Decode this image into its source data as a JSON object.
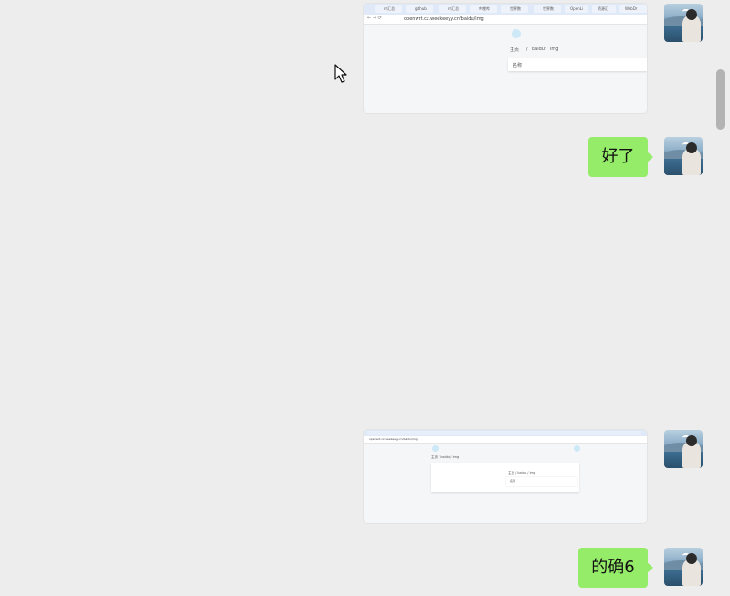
{
  "messages": [
    {
      "type": "image",
      "desc": "browser screenshot 1"
    },
    {
      "type": "text",
      "text": "好了"
    },
    {
      "type": "image",
      "desc": "browser screenshot 2"
    },
    {
      "type": "text",
      "text": "的确6"
    }
  ],
  "shot1": {
    "url": "openwrt.cz.weekeeyy.cn/baidu/img",
    "breadcrumb_home": "主页",
    "breadcrumb_sep1": "/",
    "breadcrumb_c1": "baidu",
    "breadcrumb_sep2": "/",
    "breadcrumb_c2": "img",
    "card_label": "名称",
    "tabs": [
      "nr汇总",
      "github",
      "nr汇总",
      "哔哩哔",
      "世界数",
      "世界数",
      "OpenLi",
      "资源汇",
      "WebDr"
    ]
  },
  "shot2": {
    "url": "openwrt.cz.weekeeyy.cn/baidu/img",
    "breadcrumb": "主页 / baidu / img",
    "card_breadcrumb": "主页 / baidu / img",
    "card_label": "名称"
  },
  "colors": {
    "bubble": "#95ec69",
    "background": "#ededed"
  },
  "icons": [
    "avatar",
    "cursor-icon",
    "scrollbar"
  ]
}
